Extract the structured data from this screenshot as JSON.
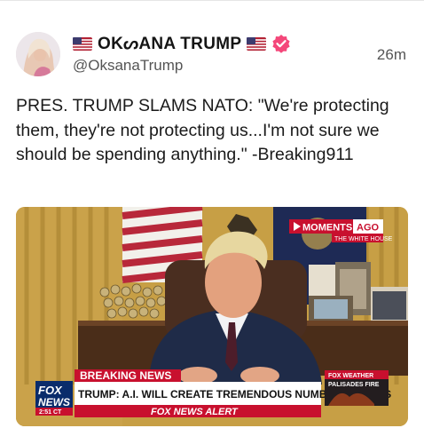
{
  "post": {
    "display_name": "OKᔕANA TRUMP",
    "handle": "@OksanaTrump",
    "time": "26m",
    "text": "PRES. TRUMP SLAMS NATO: \"We're protecting them, they're not protecting us...I'm not sure we should be spending anything.\" -Breaking911",
    "icons": [
      "us-flag-icon",
      "verified-badge-icon"
    ],
    "verified_color": "#f4477a"
  },
  "media": {
    "moments_label": "MOMENTS",
    "moments_ago": "AGO",
    "moments_sub": "THE WHITE HOUSE",
    "breaking_label": "BREAKING NEWS",
    "headline": "TRUMP: A.I. WILL CREATE TREMENDOUS NUMBER OF JOBS",
    "ticker": "FOX NEWS ALERT",
    "logo_top": "FOX",
    "logo_bottom": "NEWS",
    "logo_time": "2:51 CT",
    "weather_top": "FOX WEATHER",
    "weather_sub": "PALISADES FIRE"
  }
}
